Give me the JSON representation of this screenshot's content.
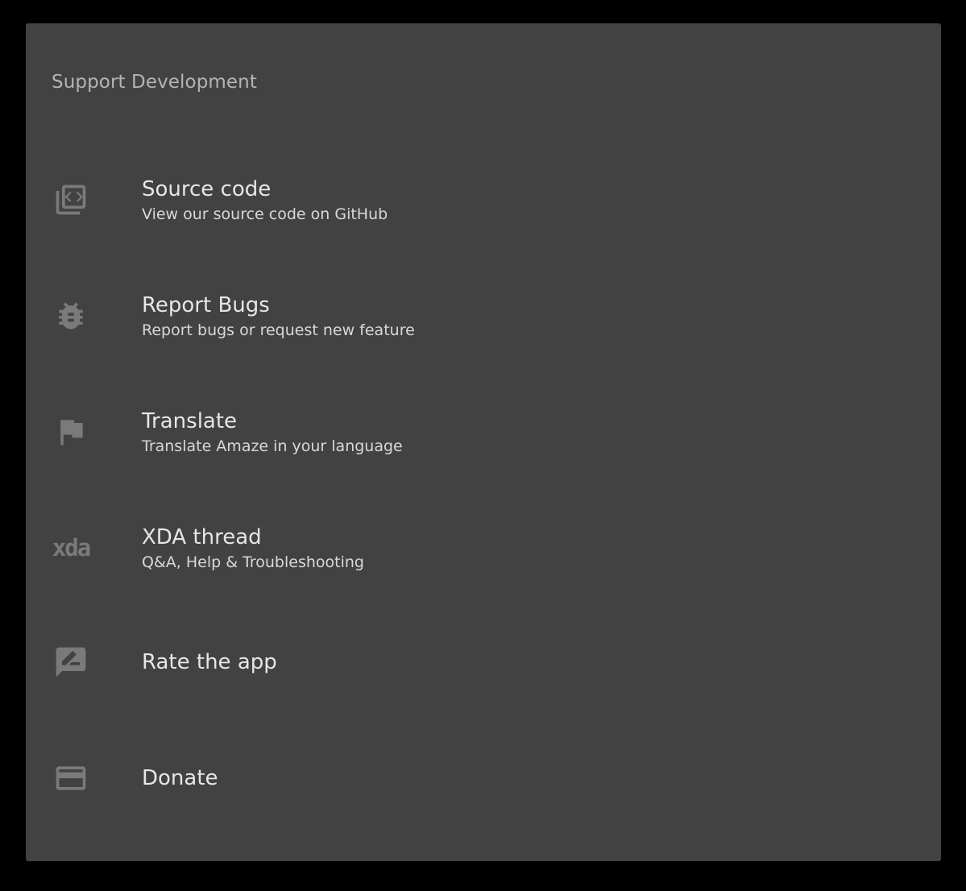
{
  "section": {
    "title": "Support Development"
  },
  "items": [
    {
      "title": "Source code",
      "summary": "View our source code on GitHub",
      "icon": "source-code-icon"
    },
    {
      "title": "Report Bugs",
      "summary": "Report bugs or request new feature",
      "icon": "bug-icon"
    },
    {
      "title": "Translate",
      "summary": "Translate Amaze in your language",
      "icon": "flag-icon"
    },
    {
      "title": "XDA thread",
      "summary": "Q&A, Help & Troubleshooting",
      "icon": "xda-icon",
      "icon_text": "xda"
    },
    {
      "title": "Rate the app",
      "icon": "rate-review-icon"
    },
    {
      "title": "Donate",
      "icon": "credit-card-icon"
    }
  ],
  "colors": {
    "background": "#000000",
    "card": "#424242",
    "icon": "#7a7a7a",
    "title_text": "#e6e6e6",
    "summary_text": "#d8d8d8",
    "section_text": "#b4b4b4"
  }
}
